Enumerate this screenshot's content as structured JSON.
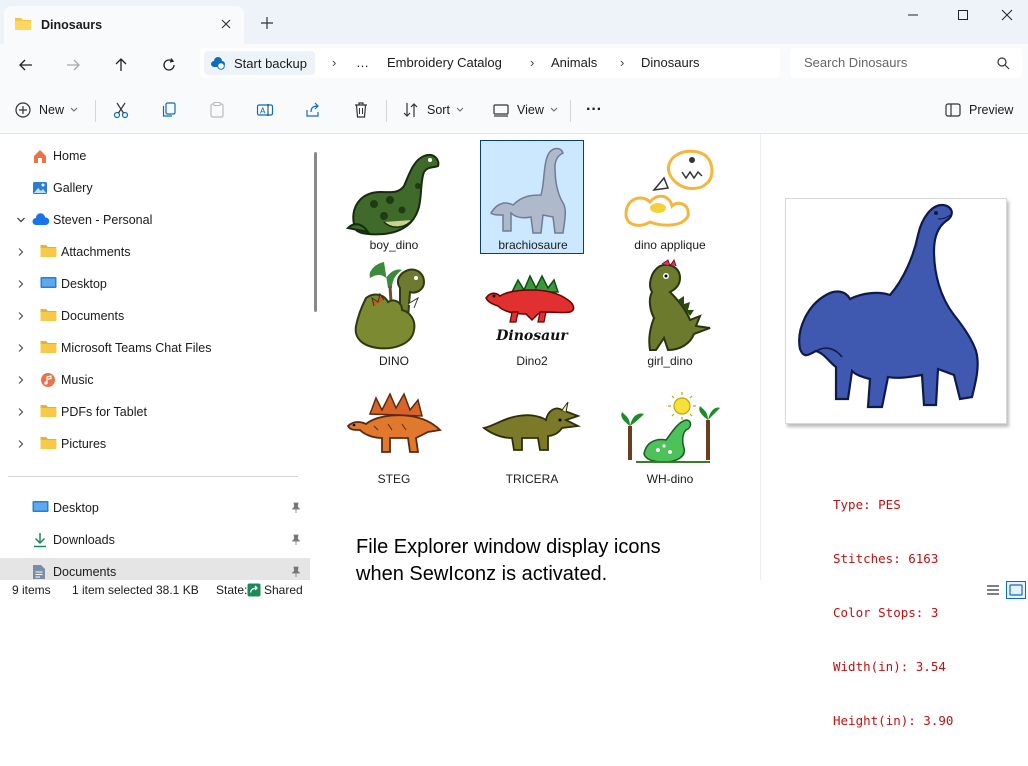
{
  "window": {
    "tab_title": "Dinosaurs",
    "controls": [
      "minimize",
      "maximize",
      "close"
    ]
  },
  "nav": {
    "backup_label": "Start backup",
    "ellipsis": "…",
    "breadcrumbs": [
      "Embroidery Catalog",
      "Animals",
      "Dinosaurs"
    ],
    "search_placeholder": "Search Dinosaurs"
  },
  "toolbar": {
    "new_label": "New",
    "sort_label": "Sort",
    "view_label": "View",
    "more_label": "···",
    "preview_label": "Preview"
  },
  "sidebar": {
    "items": [
      {
        "label": "Home",
        "icon": "home-icon"
      },
      {
        "label": "Gallery",
        "icon": "gallery-icon"
      },
      {
        "label": "Steven - Personal",
        "icon": "cloud-icon"
      },
      {
        "label": "Attachments",
        "icon": "folder-icon"
      },
      {
        "label": "Desktop",
        "icon": "desktop-icon"
      },
      {
        "label": "Documents",
        "icon": "folder-icon"
      },
      {
        "label": "Microsoft Teams Chat Files",
        "icon": "folder-icon"
      },
      {
        "label": "Music",
        "icon": "music-icon"
      },
      {
        "label": "PDFs for Tablet",
        "icon": "folder-icon"
      },
      {
        "label": "Pictures",
        "icon": "folder-icon"
      }
    ],
    "quick_access": [
      {
        "label": "Desktop",
        "icon": "desktop-icon"
      },
      {
        "label": "Downloads",
        "icon": "download-icon"
      },
      {
        "label": "Documents",
        "icon": "document-icon"
      }
    ]
  },
  "files": [
    {
      "name": "boy_dino",
      "selected": false
    },
    {
      "name": "brachiosaure",
      "selected": true
    },
    {
      "name": "dino applique",
      "selected": false
    },
    {
      "name": "DINO",
      "selected": false
    },
    {
      "name": "Dino2",
      "selected": false
    },
    {
      "name": "girl_dino",
      "selected": false
    },
    {
      "name": "STEG",
      "selected": false
    },
    {
      "name": "TRICERA",
      "selected": false
    },
    {
      "name": "WH-dino",
      "selected": false
    }
  ],
  "thumb_text": {
    "dino2_word": "Dinosaur"
  },
  "caption": {
    "line1": "File Explorer window display icons",
    "line2": "when SewIconz is activated."
  },
  "preview": {
    "type": "Type: PES",
    "stitches": "Stitches: 6163",
    "color_stops": "Color Stops: 3",
    "width": "Width(in): 3.54",
    "height": "Height(in): 3.90"
  },
  "status": {
    "item_count": "9 items",
    "selection": "1 item selected",
    "size": "38.1 KB",
    "state_label": "State:",
    "state_value": "Shared"
  },
  "colors": {
    "accent": "#0a3f73",
    "selection_bg": "#cce8ff",
    "meta_text": "#c01010",
    "folder": "#f5c541"
  }
}
